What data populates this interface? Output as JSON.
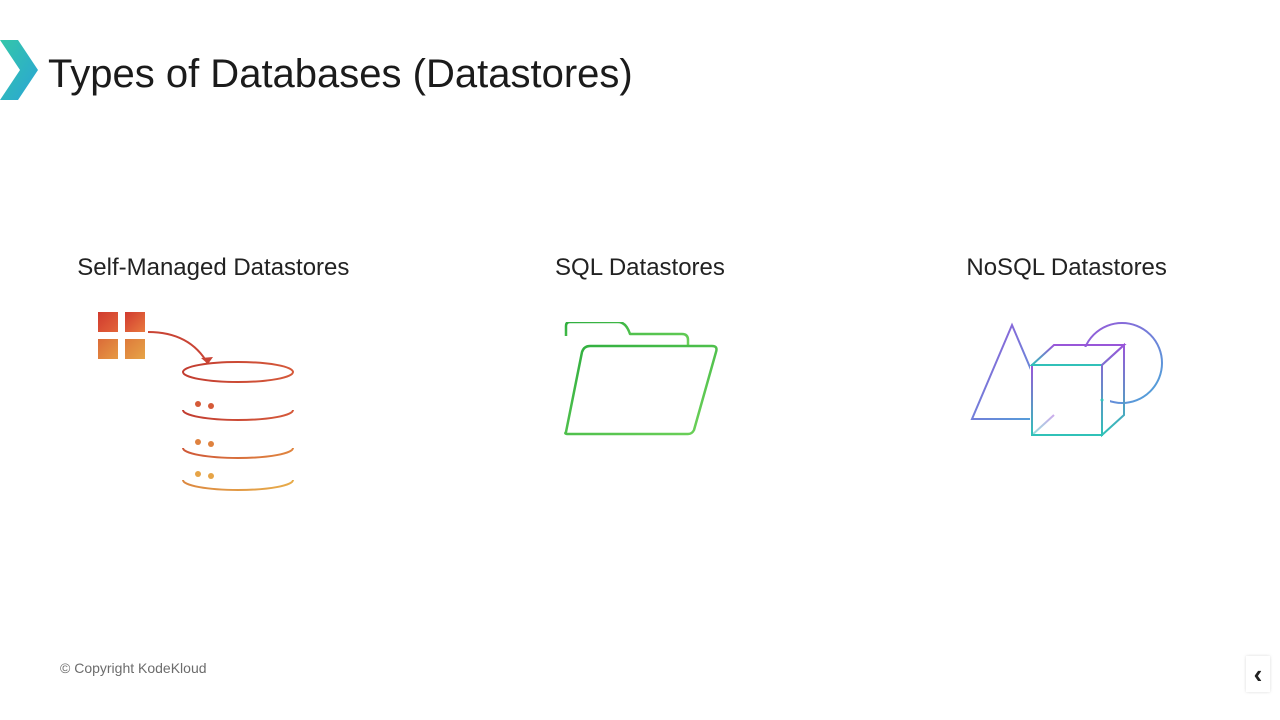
{
  "title": "Types of Databases (Datastores)",
  "columns": {
    "self_managed": {
      "label": "Self-Managed Datastores",
      "icon": "database-cylinder-icon"
    },
    "sql": {
      "label": "SQL Datastores",
      "icon": "folder-icon"
    },
    "nosql": {
      "label": "NoSQL Datastores",
      "icon": "geometric-shapes-icon"
    }
  },
  "footer": "© Copyright KodeKloud",
  "nav": {
    "back": "‹"
  }
}
